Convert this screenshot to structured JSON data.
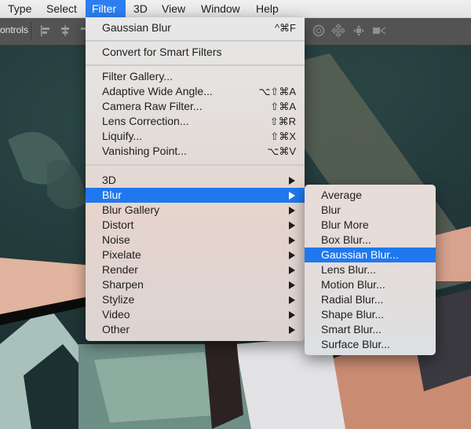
{
  "menubar": {
    "items": [
      {
        "label": "Type",
        "active": false
      },
      {
        "label": "Select",
        "active": false
      },
      {
        "label": "Filter",
        "active": true
      },
      {
        "label": "3D",
        "active": false
      },
      {
        "label": "View",
        "active": false
      },
      {
        "label": "Window",
        "active": false
      },
      {
        "label": "Help",
        "active": false
      }
    ]
  },
  "options_bar": {
    "label": "ontrols",
    "icons": [
      "align-left-icon",
      "align-center-icon",
      "align-right-icon",
      "orbit-3d-icon",
      "pan-3d-icon",
      "slide-3d-icon",
      "video-camera-3d-icon"
    ]
  },
  "filter_menu": {
    "last_filter": {
      "label": "Gaussian Blur",
      "shortcut": "^⌘F"
    },
    "convert": {
      "label": "Convert for Smart Filters"
    },
    "group2": [
      {
        "label": "Filter Gallery...",
        "shortcut": ""
      },
      {
        "label": "Adaptive Wide Angle...",
        "shortcut": "⌥⇧⌘A"
      },
      {
        "label": "Camera Raw Filter...",
        "shortcut": "⇧⌘A"
      },
      {
        "label": "Lens Correction...",
        "shortcut": "⇧⌘R"
      },
      {
        "label": "Liquify...",
        "shortcut": "⇧⌘X"
      },
      {
        "label": "Vanishing Point...",
        "shortcut": "⌥⌘V"
      }
    ],
    "submenus": [
      {
        "label": "3D",
        "highlighted": false
      },
      {
        "label": "Blur",
        "highlighted": true
      },
      {
        "label": "Blur Gallery",
        "highlighted": false
      },
      {
        "label": "Distort",
        "highlighted": false
      },
      {
        "label": "Noise",
        "highlighted": false
      },
      {
        "label": "Pixelate",
        "highlighted": false
      },
      {
        "label": "Render",
        "highlighted": false
      },
      {
        "label": "Sharpen",
        "highlighted": false
      },
      {
        "label": "Stylize",
        "highlighted": false
      },
      {
        "label": "Video",
        "highlighted": false
      },
      {
        "label": "Other",
        "highlighted": false
      }
    ]
  },
  "blur_submenu": {
    "items": [
      {
        "label": "Average",
        "highlighted": false
      },
      {
        "label": "Blur",
        "highlighted": false
      },
      {
        "label": "Blur More",
        "highlighted": false
      },
      {
        "label": "Box Blur...",
        "highlighted": false
      },
      {
        "label": "Gaussian Blur...",
        "highlighted": true
      },
      {
        "label": "Lens Blur...",
        "highlighted": false
      },
      {
        "label": "Motion Blur...",
        "highlighted": false
      },
      {
        "label": "Radial Blur...",
        "highlighted": false
      },
      {
        "label": "Shape Blur...",
        "highlighted": false
      },
      {
        "label": "Smart Blur...",
        "highlighted": false
      },
      {
        "label": "Surface Blur...",
        "highlighted": false
      }
    ]
  },
  "colors": {
    "highlight": "#1f78ee",
    "menubar_active": "#2b7ff1"
  }
}
